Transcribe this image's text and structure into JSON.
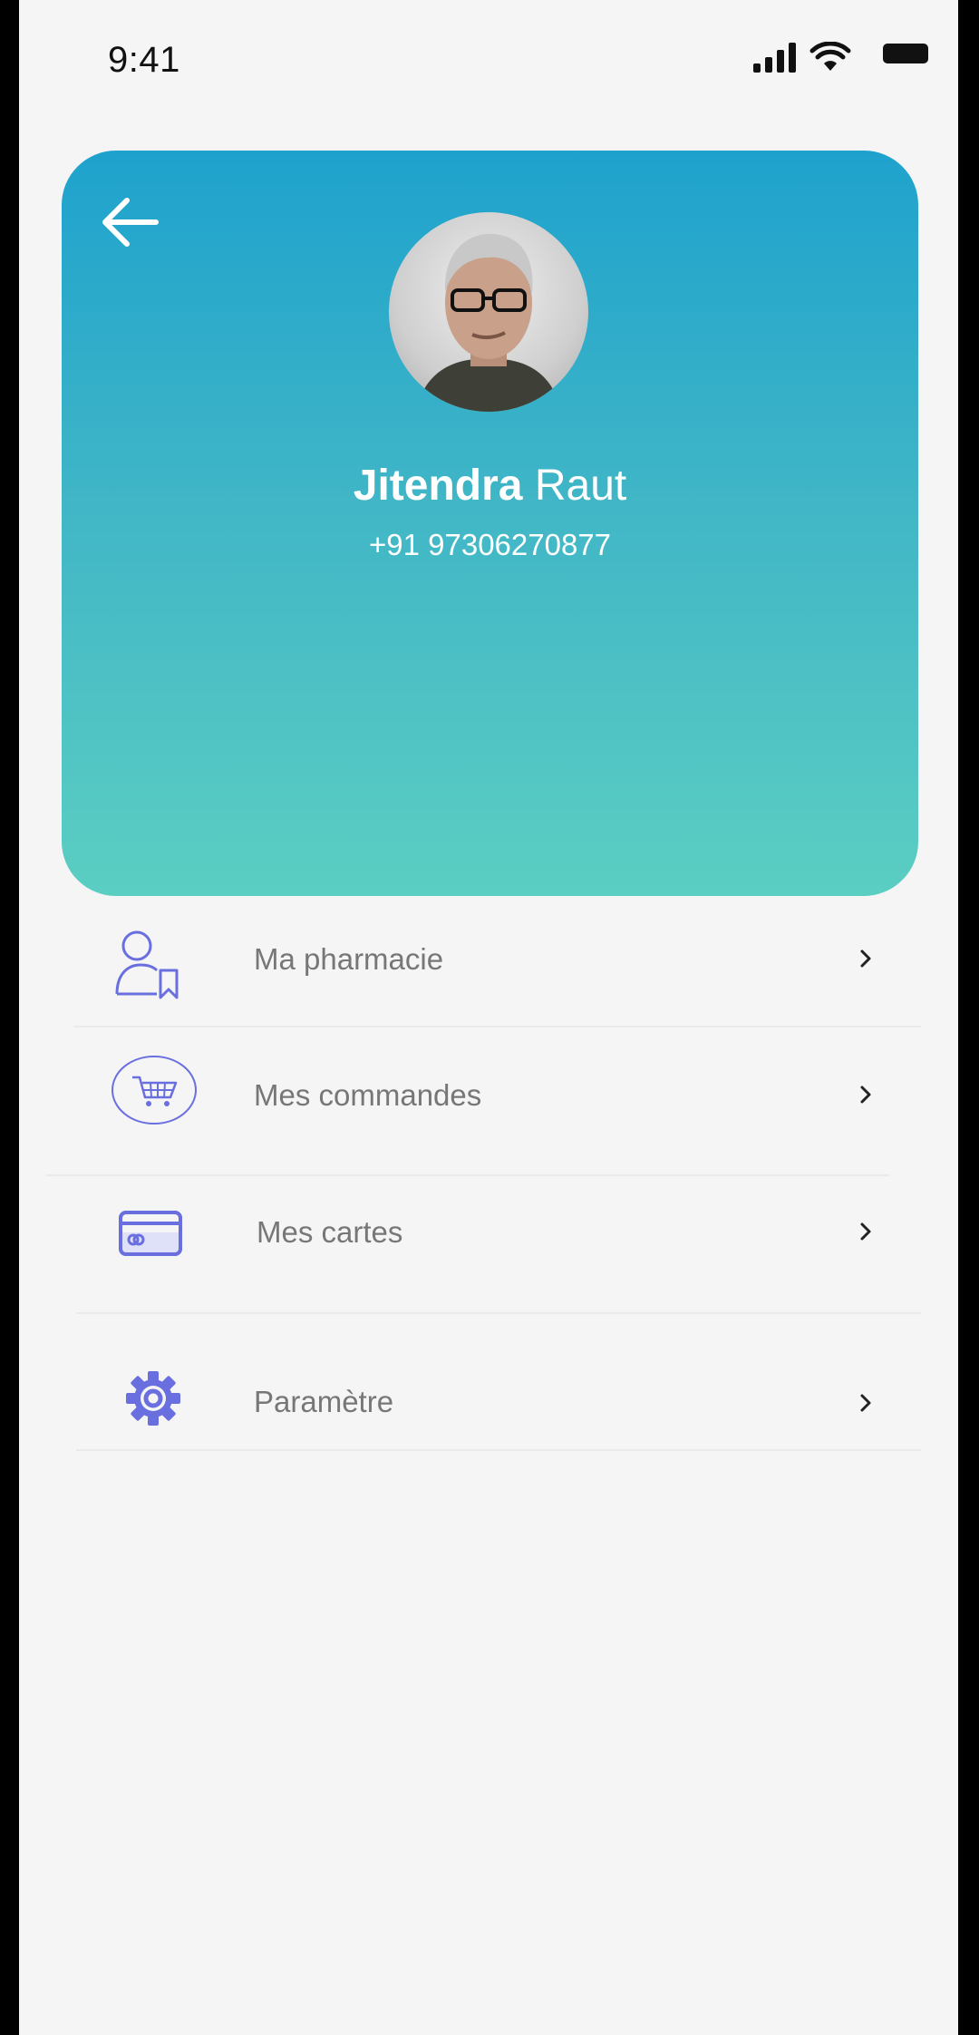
{
  "status_bar": {
    "time": "9:41"
  },
  "profile": {
    "first_name": "Jitendra",
    "last_name": "Raut",
    "phone": "+91 97306270877"
  },
  "menu": {
    "items": [
      {
        "label": "Ma pharmacie",
        "icon": "user-bookmark-icon"
      },
      {
        "label": "Mes commandes",
        "icon": "shopping-cart-icon"
      },
      {
        "label": "Mes cartes",
        "icon": "credit-card-icon"
      },
      {
        "label": "Paramètre",
        "icon": "gear-icon"
      }
    ]
  },
  "colors": {
    "gradient_top": "#1ea2cd",
    "gradient_bottom": "#5bcec2",
    "icon_accent": "#6a6fe0",
    "label_gray": "#777777"
  }
}
